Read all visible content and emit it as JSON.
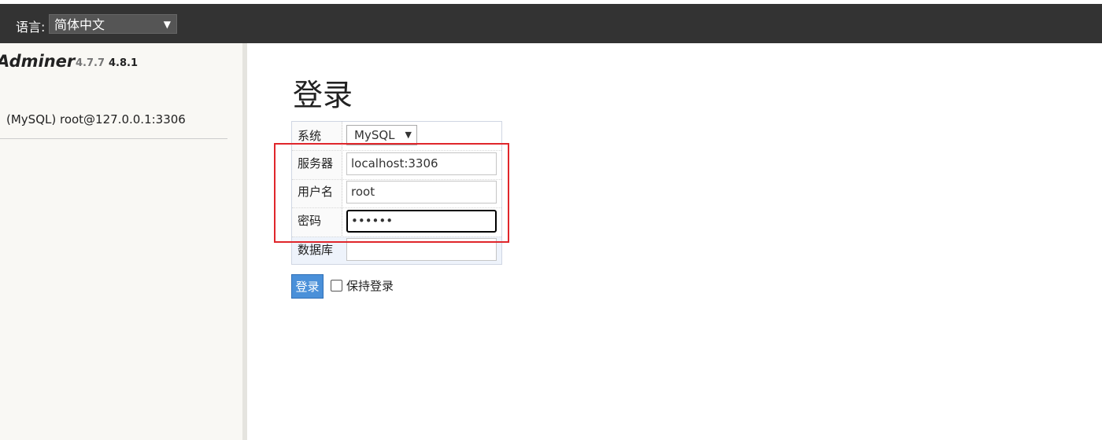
{
  "language_bar": {
    "label": "语言:",
    "selected": "简体中文",
    "chevron_icon": "chevron-down-icon"
  },
  "sidebar": {
    "brand": "Adminer",
    "version_old": "4.7.7",
    "version_new": "4.8.1",
    "server_item": "(MySQL) root@127.0.0.1:3306"
  },
  "main": {
    "title": "登录",
    "fields": {
      "system": {
        "label": "系统",
        "value": "MySQL"
      },
      "server": {
        "label": "服务器",
        "value": "localhost:3306"
      },
      "username": {
        "label": "用户名",
        "value": "root"
      },
      "password": {
        "label": "密码",
        "value": "••••••"
      },
      "database": {
        "label": "数据库",
        "value": ""
      }
    },
    "login_button": "登录",
    "keep_login_label": "保持登录"
  },
  "colors": {
    "lang_bar_bg": "#333333",
    "sidebar_bg": "#f9f8f4",
    "button_blue": "#4a90d9",
    "highlight_red": "#e0262b"
  }
}
